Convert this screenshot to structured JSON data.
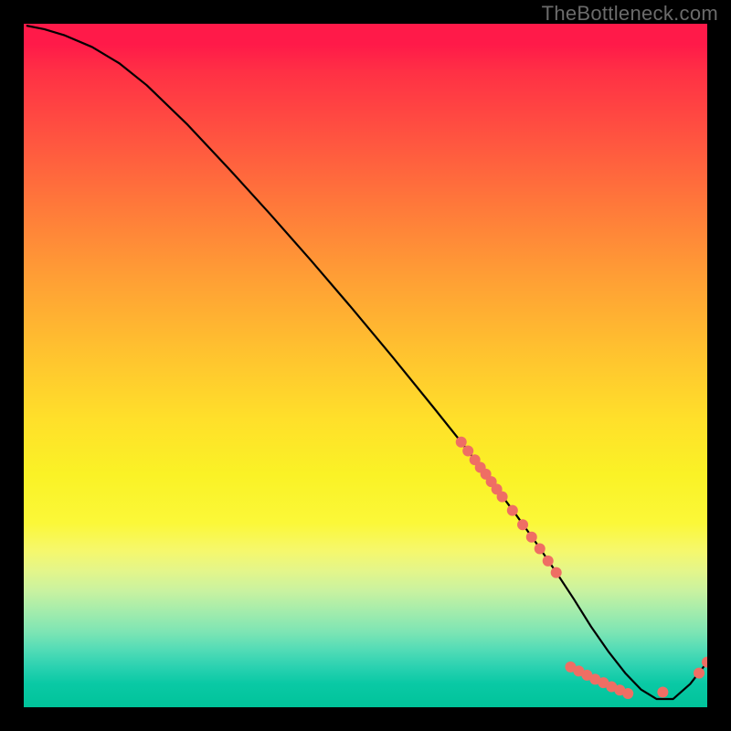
{
  "watermark": "TheBottleneck.com",
  "colors": {
    "background": "#000000",
    "marker": "#ef6e64",
    "curve": "#000000"
  },
  "chart_data": {
    "type": "line",
    "title": "",
    "xlabel": "",
    "ylabel": "",
    "xlim": [
      0,
      100
    ],
    "ylim": [
      0,
      100
    ],
    "grid": false,
    "legend": false,
    "series": [
      {
        "name": "curve",
        "x": [
          0.5,
          3,
          6,
          10,
          14,
          18,
          24,
          30,
          36,
          42,
          48,
          54,
          60,
          64,
          68,
          72,
          75,
          78,
          80.5,
          83,
          85.5,
          88,
          90.3,
          92.6,
          95,
          97.5,
          100
        ],
        "y": [
          99.7,
          99.2,
          98.3,
          96.6,
          94.2,
          91.0,
          85.2,
          78.8,
          72.2,
          65.4,
          58.4,
          51.2,
          43.8,
          38.8,
          33.6,
          28.2,
          24.0,
          19.6,
          15.8,
          11.8,
          8.2,
          5.0,
          2.6,
          1.2,
          1.2,
          3.4,
          6.6
        ]
      }
    ],
    "markers": [
      {
        "x": 64.0,
        "y": 38.8
      },
      {
        "x": 65.0,
        "y": 37.5
      },
      {
        "x": 66.0,
        "y": 36.2
      },
      {
        "x": 66.8,
        "y": 35.1
      },
      {
        "x": 67.6,
        "y": 34.1
      },
      {
        "x": 68.4,
        "y": 33.0
      },
      {
        "x": 69.2,
        "y": 31.9
      },
      {
        "x": 70.0,
        "y": 30.8
      },
      {
        "x": 71.5,
        "y": 28.8
      },
      {
        "x": 73.0,
        "y": 26.7
      },
      {
        "x": 74.3,
        "y": 24.9
      },
      {
        "x": 75.5,
        "y": 23.2
      },
      {
        "x": 76.7,
        "y": 21.4
      },
      {
        "x": 77.9,
        "y": 19.7
      },
      {
        "x": 80.0,
        "y": 5.9
      },
      {
        "x": 81.2,
        "y": 5.3
      },
      {
        "x": 82.4,
        "y": 4.7
      },
      {
        "x": 83.6,
        "y": 4.1
      },
      {
        "x": 84.8,
        "y": 3.6
      },
      {
        "x": 86.0,
        "y": 3.0
      },
      {
        "x": 87.2,
        "y": 2.5
      },
      {
        "x": 88.4,
        "y": 2.0
      },
      {
        "x": 93.5,
        "y": 2.2
      },
      {
        "x": 98.8,
        "y": 5.0
      },
      {
        "x": 100.0,
        "y": 6.6
      }
    ]
  }
}
